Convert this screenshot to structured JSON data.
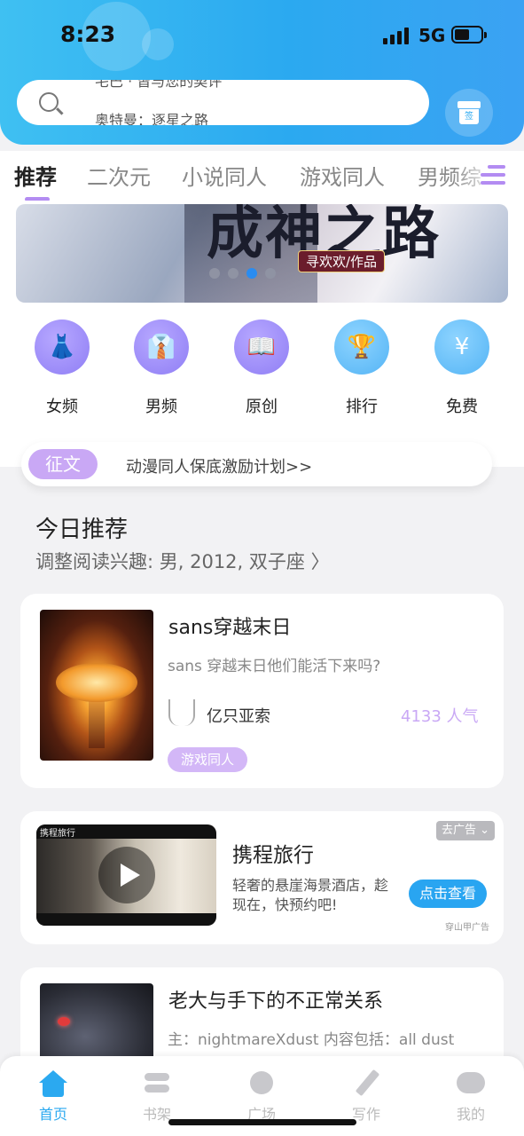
{
  "status_bar": {
    "time": "8:23",
    "network": "5G"
  },
  "search": {
    "line1": "宅巴 · 皆与您的契评",
    "line2": "奥特曼：逐星之路"
  },
  "gift": {
    "label": "签"
  },
  "tabs": [
    "推荐",
    "二次元",
    "小说同人",
    "游戏同人",
    "男频综"
  ],
  "banner": {
    "title": "成神之路",
    "author": "寻欢欢/作品"
  },
  "quick_nav": [
    {
      "label": "女频",
      "icon": "dress-icon",
      "glyph": "👗"
    },
    {
      "label": "男频",
      "icon": "shirt-icon",
      "glyph": "👔"
    },
    {
      "label": "原创",
      "icon": "book-icon",
      "glyph": "📖"
    },
    {
      "label": "排行",
      "icon": "trophy-icon",
      "glyph": "🏆"
    },
    {
      "label": "免费",
      "icon": "yen-coin-icon",
      "glyph": "¥"
    }
  ],
  "notice": {
    "tag": "征文",
    "text": "动漫同人保底激励计划>>"
  },
  "today": {
    "title": "今日推荐",
    "subtitle": "调整阅读兴趣: 男, 2012, 双子座 〉"
  },
  "books": [
    {
      "title": "sans穿越末日",
      "desc": "sans 穿越末日他们能活下来吗?",
      "author": "亿只亚索",
      "popularity": "4133 人气",
      "tag": "游戏同人"
    },
    {
      "title": "老大与手下的不正常关系",
      "desc": "主：nightmareXdust 内容包括：all dust"
    }
  ],
  "ad": {
    "close_label": "去广告 ⌄",
    "brand": "携程旅行",
    "title": "携程旅行",
    "desc": "轻奢的悬崖海景酒店，趁现在，快预约吧!",
    "cta": "点击查看",
    "source": "穿山甲广告"
  },
  "bottom_nav": [
    {
      "label": "首页",
      "active": true
    },
    {
      "label": "书架",
      "active": false
    },
    {
      "label": "广场",
      "active": false
    },
    {
      "label": "写作",
      "active": false
    },
    {
      "label": "我的",
      "active": false
    }
  ],
  "colors": {
    "header_blue": "#2ba9f0",
    "accent_purple": "#b38cf2",
    "tag_purple": "#c9a8f5"
  }
}
